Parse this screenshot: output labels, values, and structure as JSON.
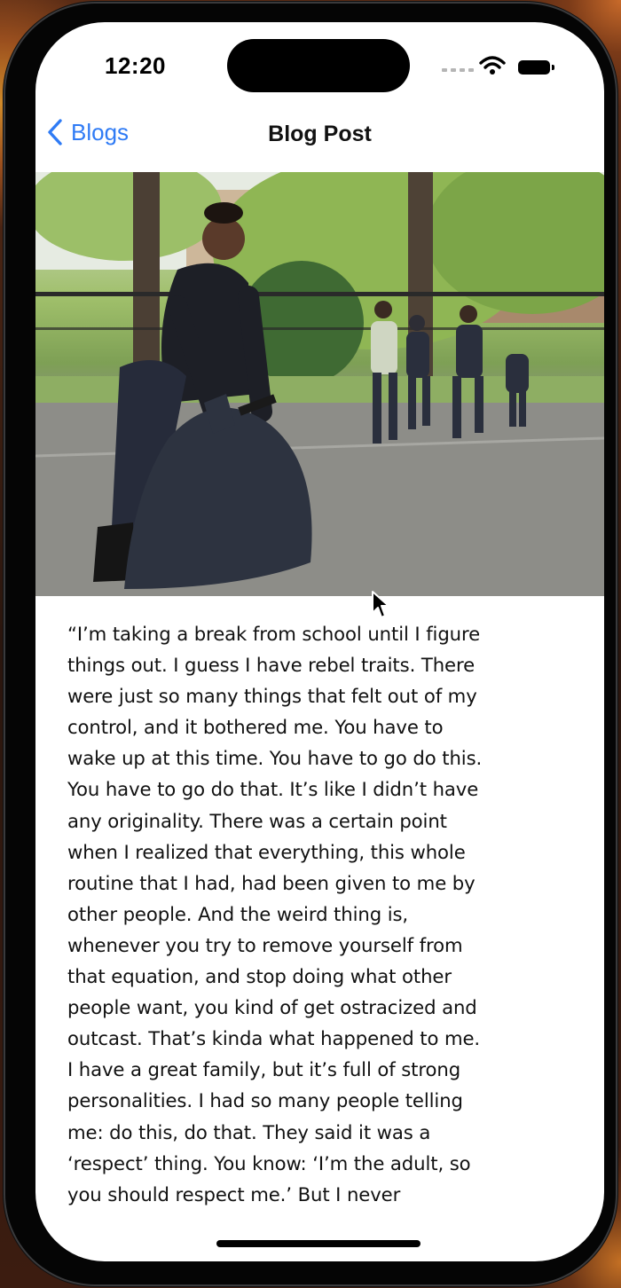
{
  "status": {
    "time": "12:20"
  },
  "nav": {
    "back_label": "Blogs",
    "title": "Blog Post"
  },
  "article": {
    "lines": [
      "“I’m taking a break from school until I figure",
      "things out. I guess I have rebel traits. There",
      "were just so many things that felt out of my",
      "control, and it bothered me. You have to",
      "wake up at this time. You have to go do this.",
      "You have to go do that. It’s like I didn’t have",
      "any originality. There was a certain point",
      "when I realized that everything, this whole",
      "routine that I had, had been given to me by",
      "other people. And the weird thing is,",
      "whenever you try to remove yourself from",
      "that equation, and stop doing what other",
      "people want, you kind of get ostracized and",
      "outcast. That’s kinda what happened to me.",
      "I have a great family, but it’s full of strong",
      "personalities. I had so many people telling",
      "me: do this, do that. They said it was a",
      "‘respect’ thing. You know: ‘I’m the adult, so",
      "you should respect me.’ But I never"
    ]
  },
  "icons": {
    "back": "chevron-left-icon",
    "signal": "cellular-signal-icon",
    "wifi": "wifi-icon",
    "battery": "battery-icon",
    "cursor": "mouse-pointer-icon"
  },
  "colors": {
    "accent": "#2F7BF5",
    "text": "#111111",
    "background": "#FFFFFF"
  }
}
